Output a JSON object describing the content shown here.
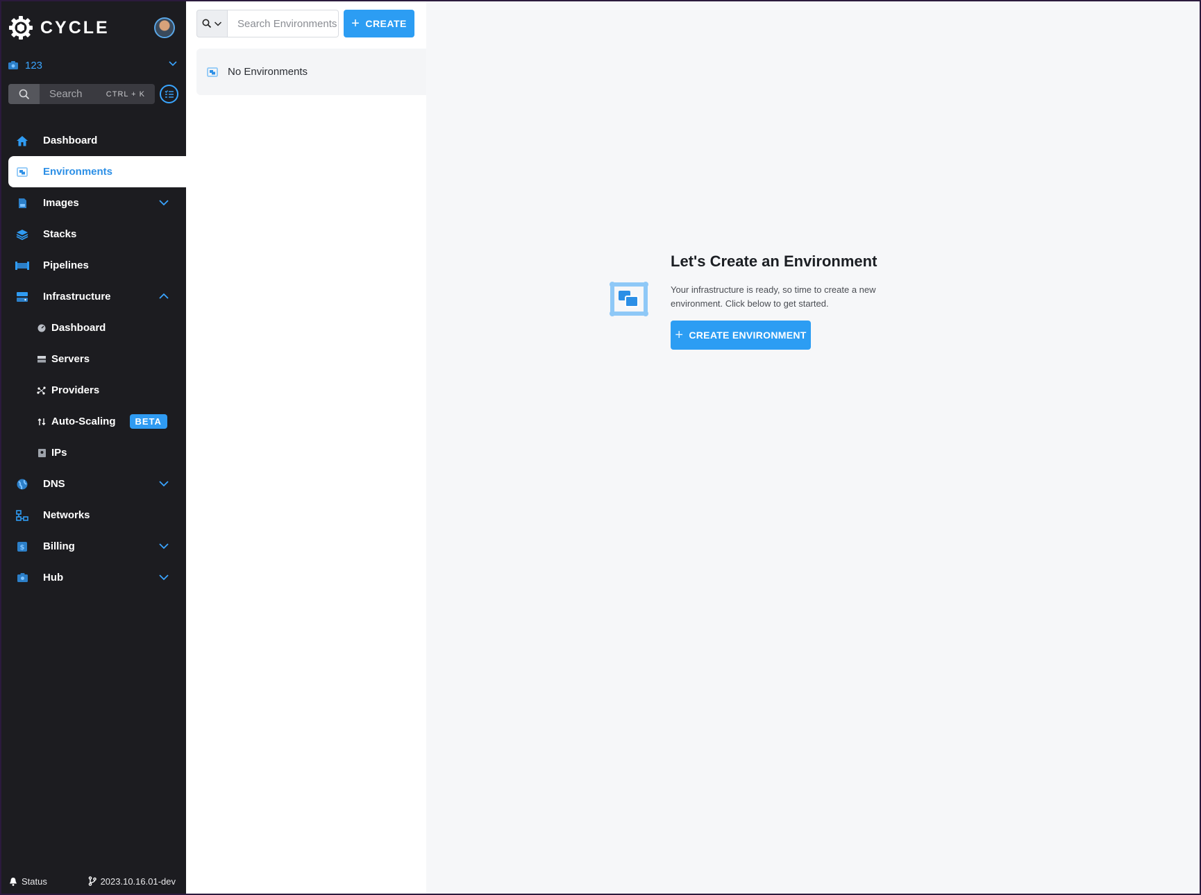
{
  "brand": {
    "name": "CYCLE",
    "logo_icon": "cycle-gear-logo-icon"
  },
  "hub": {
    "name": "123",
    "icon": "hub-icon"
  },
  "search": {
    "placeholder": "Search",
    "shortcut": "CTRL + K"
  },
  "nav": {
    "dashboard": "Dashboard",
    "environments": "Environments",
    "images": "Images",
    "stacks": "Stacks",
    "pipelines": "Pipelines",
    "infrastructure": "Infrastructure",
    "infra_dashboard": "Dashboard",
    "servers": "Servers",
    "providers": "Providers",
    "auto_scaling": "Auto-Scaling",
    "beta": "BETA",
    "ips": "IPs",
    "dns": "DNS",
    "networks": "Networks",
    "billing": "Billing",
    "hub": "Hub"
  },
  "footer": {
    "status": "Status",
    "version": "2023.10.16.01-dev"
  },
  "list": {
    "search_placeholder": "Search Environments",
    "create_label": "CREATE",
    "empty_text": "No Environments"
  },
  "main": {
    "title": "Let's Create an Environment",
    "description": "Your infrastructure is ready, so time to create a new environment. Click below to get started.",
    "button_label": "CREATE ENVIRONMENT"
  },
  "colors": {
    "accent": "#2c9df3",
    "sidebar_bg": "#1c1c20",
    "active_text": "#2c8fe6"
  }
}
